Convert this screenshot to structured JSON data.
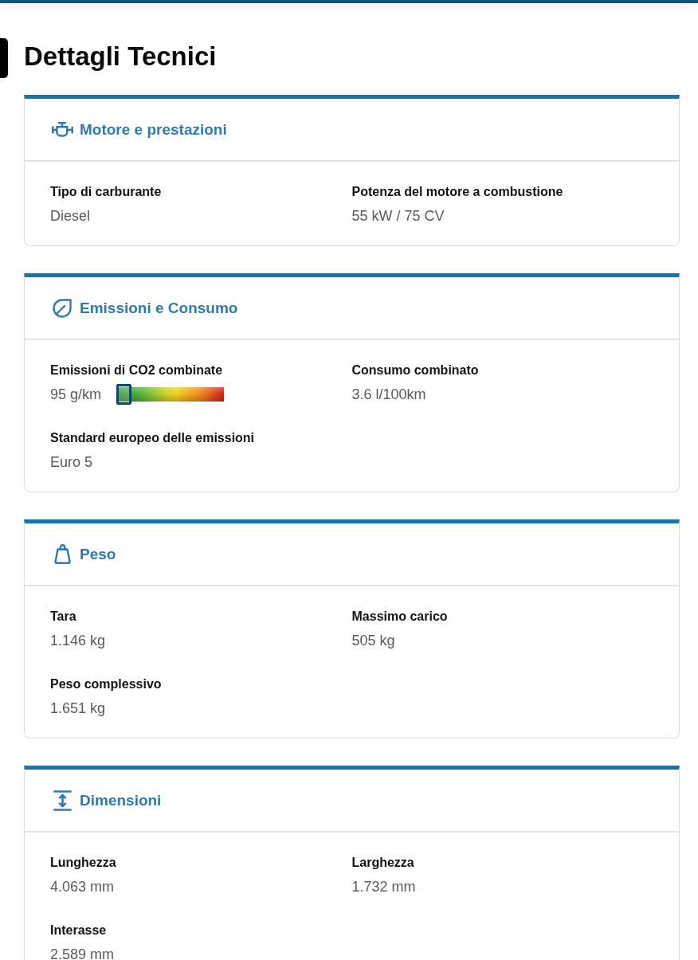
{
  "page": {
    "title": "Dettagli Tecnici"
  },
  "sections": [
    {
      "title": "Motore e prestazioni",
      "items": [
        {
          "kind": "plain",
          "label": "Tipo di carburante",
          "value": "Diesel"
        },
        {
          "kind": "plain",
          "label": "Potenza del motore a combustione",
          "value": "55 kW / 75 CV"
        }
      ]
    },
    {
      "title": "Emissioni e Consumo",
      "items": [
        {
          "kind": "meter",
          "label": "Emissioni di CO2 combinate",
          "value": "95 g/km",
          "level": 0
        },
        {
          "kind": "plain",
          "label": "Consumo combinato",
          "value": "3.6 l/100km"
        },
        {
          "kind": "plain",
          "label": "Standard europeo delle emissioni",
          "value": "Euro 5"
        }
      ]
    },
    {
      "title": "Peso",
      "items": [
        {
          "kind": "plain",
          "label": "Tara",
          "value": "1.146 kg"
        },
        {
          "kind": "plain",
          "label": "Massimo carico",
          "value": "505 kg"
        },
        {
          "kind": "plain",
          "label": "Peso complessivo",
          "value": "1.651 kg"
        }
      ]
    },
    {
      "title": "Dimensioni",
      "items": [
        {
          "kind": "plain",
          "label": "Lunghezza",
          "value": "4.063 mm"
        },
        {
          "kind": "plain",
          "label": "Larghezza",
          "value": "1.732 mm"
        },
        {
          "kind": "plain",
          "label": "Interasse",
          "value": "2.589 mm"
        }
      ]
    }
  ]
}
